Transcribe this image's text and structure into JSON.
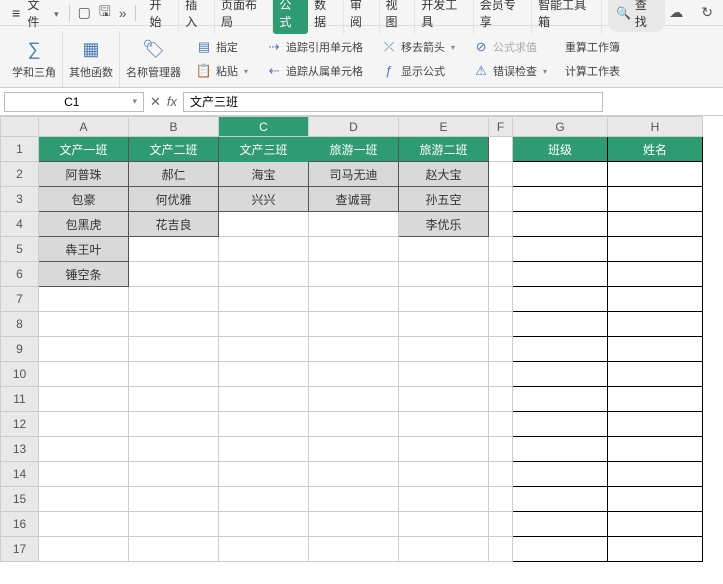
{
  "menu": {
    "file": "文件",
    "tabs": [
      "开始",
      "插入",
      "页面布局",
      "公式",
      "数据",
      "审阅",
      "视图",
      "开发工具",
      "会员专享",
      "智能工具箱"
    ],
    "active_tab_index": 3,
    "search": "查找"
  },
  "ribbon": {
    "trig": "学和三角",
    "other_funcs": "其他函数",
    "name_mgr": "名称管理器",
    "paste": "粘贴",
    "specify": "指定",
    "trace_precedents": "追踪引用单元格",
    "trace_dependents": "追踪从属单元格",
    "move_arrow": "移去箭头",
    "show_formulas": "显示公式",
    "eval_formula": "公式求值",
    "error_check": "错误检查",
    "recalc_book": "重算工作簿",
    "calc_sheet": "计算工作表"
  },
  "namebox_value": "C1",
  "formula_value": "文产三班",
  "sheet": {
    "columns": [
      "A",
      "B",
      "C",
      "D",
      "E",
      "F",
      "G",
      "H"
    ],
    "selected_col": "C",
    "rows": 17,
    "headers": {
      "A": "文产一班",
      "B": "文产二班",
      "C": "文产三班",
      "D": "旅游一班",
      "E": "旅游二班",
      "G": "班级",
      "H": "姓名"
    },
    "data": {
      "A": [
        "阿普珠",
        "包豪",
        "包黑虎",
        "犇王叶",
        "锤空条"
      ],
      "B": [
        "郝仁",
        "何优雅",
        "花吉良"
      ],
      "C": [
        "海宝",
        "兴兴"
      ],
      "D": [
        "司马无迪",
        "查诚哥"
      ],
      "E": [
        "赵大宝",
        "孙五空",
        "李优乐"
      ]
    }
  }
}
